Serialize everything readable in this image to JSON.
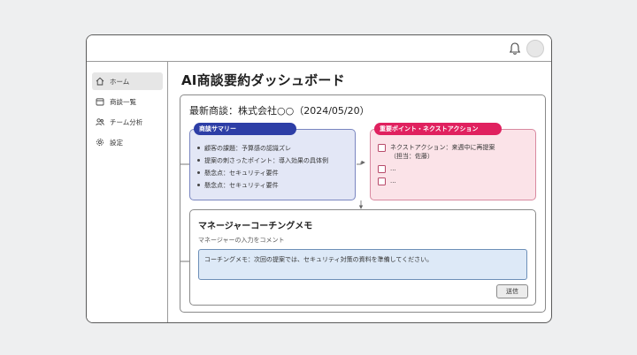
{
  "colors": {
    "summary_accent": "#2d3ea6",
    "summary_bg": "#e3e7f6",
    "points_accent": "#e0215f",
    "points_bg": "#fbe3e8",
    "memo_bg": "#dde9f7"
  },
  "header": {
    "bell_icon": "bell-icon",
    "avatar": "user-avatar"
  },
  "sidebar": {
    "items": [
      {
        "label": "ホーム",
        "icon": "home-icon",
        "active": true
      },
      {
        "label": "商談一覧",
        "icon": "calendar-icon",
        "active": false
      },
      {
        "label": "チーム分析",
        "icon": "team-icon",
        "active": false
      },
      {
        "label": "設定",
        "icon": "gear-icon",
        "active": false
      }
    ]
  },
  "main": {
    "title": "AI商談要約ダッシュボード",
    "deal_title": "最新商談：株式会社○○（2024/05/20）",
    "summary": {
      "heading": "商談サマリー",
      "items": [
        "顧客の課題：予算感の認識ズレ",
        "提案の刺さったポイント：導入効果の具体例",
        "懸念点：セキュリティ要件",
        "懸念点：セキュリティ要件"
      ]
    },
    "points": {
      "heading": "重要ポイント・ネクストアクション",
      "items": [
        {
          "line1": "ネクストアクション：来週中に再提案",
          "line2": "（担当：佐藤）"
        },
        {
          "line1": "...",
          "line2": ""
        },
        {
          "line1": "...",
          "line2": ""
        }
      ]
    },
    "coaching": {
      "title": "マネージャーコーチングメモ",
      "subtitle": "マネージャーの入力をコメント",
      "memo_value": "コーチングメモ：次回の提案では、セキュリティ対策の資料を準備してください。",
      "send_label": "送信"
    }
  }
}
